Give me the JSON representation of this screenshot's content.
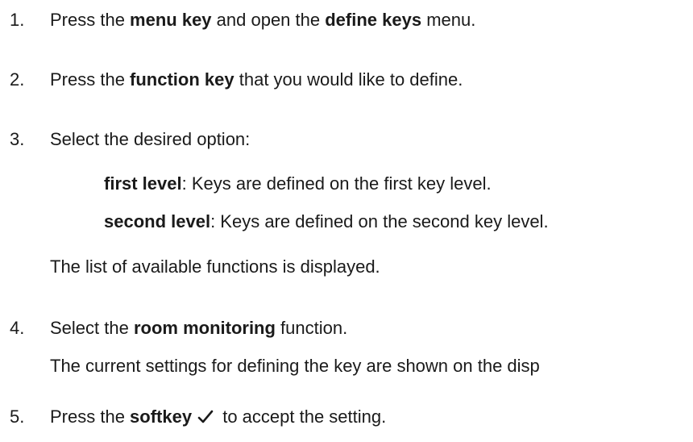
{
  "steps": [
    {
      "number": "1.",
      "parts": [
        "Press the ",
        "menu key",
        " and open the ",
        "define keys",
        " menu."
      ]
    },
    {
      "number": "2.",
      "parts": [
        "Press the ",
        "function key",
        " that you would like to define."
      ]
    },
    {
      "number": "3.",
      "text": "Select the desired option:",
      "options": [
        {
          "term": "first level",
          "desc": ": Keys are defined on the first key level."
        },
        {
          "term": "second level",
          "desc": ": Keys are defined on the second key level."
        }
      ],
      "result": "The list of available functions is displayed."
    },
    {
      "number": "4.",
      "parts": [
        "Select the ",
        "room monitoring",
        " function."
      ],
      "result": "The current settings for defining the key are shown on the disp"
    },
    {
      "number": "5.",
      "parts": [
        "Press the ",
        "softkey",
        " to accept the setting."
      ],
      "icon": "checkmark-icon"
    }
  ]
}
